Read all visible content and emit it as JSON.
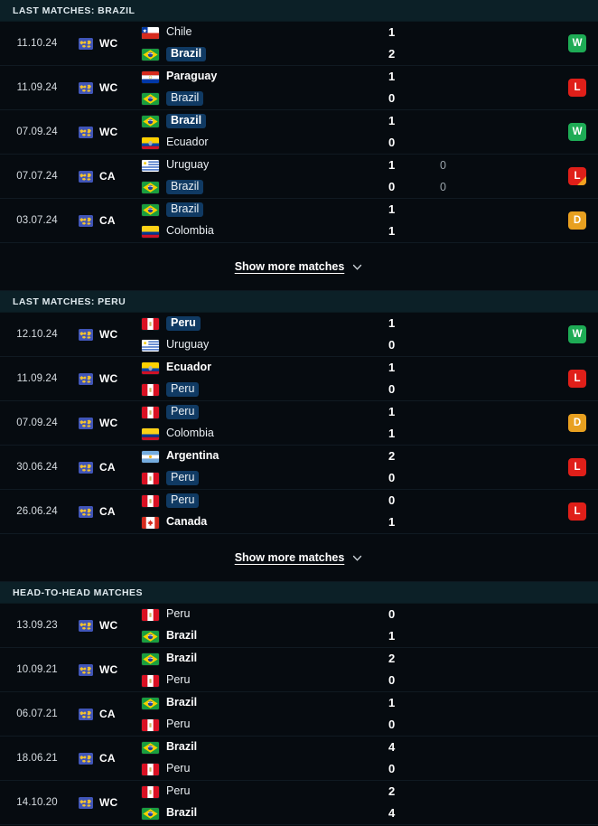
{
  "colors": {
    "page_bg": "#05090d",
    "row_bg": "#060b10",
    "section_header_bg": "#0c2027",
    "highlight_badge": "#103a63",
    "win": "#1eab55",
    "loss": "#e01f19",
    "draw": "#e8a020",
    "penalty_corner": "#f0a020"
  },
  "sections": [
    {
      "id": "last-matches-brazil",
      "title": "LAST MATCHES: BRAZIL",
      "show_more": {
        "label": "Show more matches",
        "icon": "chevron-down-icon"
      },
      "matches": [
        {
          "date": "11.10.24",
          "competition": "WC",
          "competition_icon": "world-cup-icon",
          "home": {
            "team": "Chile",
            "flag": "cl",
            "highlight": false,
            "bold": false
          },
          "away": {
            "team": "Brazil",
            "flag": "br",
            "highlight": true,
            "bold": true
          },
          "score_home": "1",
          "score_away": "2",
          "pen_home": "",
          "pen_away": "",
          "result": "W",
          "penalty_marker": false
        },
        {
          "date": "11.09.24",
          "competition": "WC",
          "competition_icon": "world-cup-icon",
          "home": {
            "team": "Paraguay",
            "flag": "py",
            "highlight": false,
            "bold": true
          },
          "away": {
            "team": "Brazil",
            "flag": "br",
            "highlight": true,
            "bold": false
          },
          "score_home": "1",
          "score_away": "0",
          "pen_home": "",
          "pen_away": "",
          "result": "L",
          "penalty_marker": false
        },
        {
          "date": "07.09.24",
          "competition": "WC",
          "competition_icon": "world-cup-icon",
          "home": {
            "team": "Brazil",
            "flag": "br",
            "highlight": true,
            "bold": true
          },
          "away": {
            "team": "Ecuador",
            "flag": "ec",
            "highlight": false,
            "bold": false
          },
          "score_home": "1",
          "score_away": "0",
          "pen_home": "",
          "pen_away": "",
          "result": "W",
          "penalty_marker": false
        },
        {
          "date": "07.07.24",
          "competition": "CA",
          "competition_icon": "world-cup-icon",
          "home": {
            "team": "Uruguay",
            "flag": "uy",
            "highlight": false,
            "bold": false
          },
          "away": {
            "team": "Brazil",
            "flag": "br",
            "highlight": true,
            "bold": false
          },
          "score_home": "1",
          "score_away": "0",
          "pen_home": "0",
          "pen_away": "0",
          "result": "L",
          "penalty_marker": true
        },
        {
          "date": "03.07.24",
          "competition": "CA",
          "competition_icon": "world-cup-icon",
          "home": {
            "team": "Brazil",
            "flag": "br",
            "highlight": true,
            "bold": false
          },
          "away": {
            "team": "Colombia",
            "flag": "co",
            "highlight": false,
            "bold": false
          },
          "score_home": "1",
          "score_away": "1",
          "pen_home": "",
          "pen_away": "",
          "result": "D",
          "penalty_marker": false
        }
      ]
    },
    {
      "id": "last-matches-peru",
      "title": "LAST MATCHES: PERU",
      "show_more": {
        "label": "Show more matches",
        "icon": "chevron-down-icon"
      },
      "matches": [
        {
          "date": "12.10.24",
          "competition": "WC",
          "competition_icon": "world-cup-icon",
          "home": {
            "team": "Peru",
            "flag": "pe",
            "highlight": true,
            "bold": true
          },
          "away": {
            "team": "Uruguay",
            "flag": "uy",
            "highlight": false,
            "bold": false
          },
          "score_home": "1",
          "score_away": "0",
          "pen_home": "",
          "pen_away": "",
          "result": "W",
          "penalty_marker": false
        },
        {
          "date": "11.09.24",
          "competition": "WC",
          "competition_icon": "world-cup-icon",
          "home": {
            "team": "Ecuador",
            "flag": "ec",
            "highlight": false,
            "bold": true
          },
          "away": {
            "team": "Peru",
            "flag": "pe",
            "highlight": true,
            "bold": false
          },
          "score_home": "1",
          "score_away": "0",
          "pen_home": "",
          "pen_away": "",
          "result": "L",
          "penalty_marker": false
        },
        {
          "date": "07.09.24",
          "competition": "WC",
          "competition_icon": "world-cup-icon",
          "home": {
            "team": "Peru",
            "flag": "pe",
            "highlight": true,
            "bold": false
          },
          "away": {
            "team": "Colombia",
            "flag": "co",
            "highlight": false,
            "bold": false
          },
          "score_home": "1",
          "score_away": "1",
          "pen_home": "",
          "pen_away": "",
          "result": "D",
          "penalty_marker": false
        },
        {
          "date": "30.06.24",
          "competition": "CA",
          "competition_icon": "world-cup-icon",
          "home": {
            "team": "Argentina",
            "flag": "ar",
            "highlight": false,
            "bold": true
          },
          "away": {
            "team": "Peru",
            "flag": "pe",
            "highlight": true,
            "bold": false
          },
          "score_home": "2",
          "score_away": "0",
          "pen_home": "",
          "pen_away": "",
          "result": "L",
          "penalty_marker": false
        },
        {
          "date": "26.06.24",
          "competition": "CA",
          "competition_icon": "world-cup-icon",
          "home": {
            "team": "Peru",
            "flag": "pe",
            "highlight": true,
            "bold": false
          },
          "away": {
            "team": "Canada",
            "flag": "ca",
            "highlight": false,
            "bold": true
          },
          "score_home": "0",
          "score_away": "1",
          "pen_home": "",
          "pen_away": "",
          "result": "L",
          "penalty_marker": false
        }
      ]
    },
    {
      "id": "head-to-head-matches",
      "title": "HEAD-TO-HEAD MATCHES",
      "show_more": null,
      "matches": [
        {
          "date": "13.09.23",
          "competition": "WC",
          "competition_icon": "world-cup-icon",
          "home": {
            "team": "Peru",
            "flag": "pe",
            "highlight": false,
            "bold": false
          },
          "away": {
            "team": "Brazil",
            "flag": "br",
            "highlight": false,
            "bold": true
          },
          "score_home": "0",
          "score_away": "1",
          "pen_home": "",
          "pen_away": "",
          "result": "",
          "penalty_marker": false
        },
        {
          "date": "10.09.21",
          "competition": "WC",
          "competition_icon": "world-cup-icon",
          "home": {
            "team": "Brazil",
            "flag": "br",
            "highlight": false,
            "bold": true
          },
          "away": {
            "team": "Peru",
            "flag": "pe",
            "highlight": false,
            "bold": false
          },
          "score_home": "2",
          "score_away": "0",
          "pen_home": "",
          "pen_away": "",
          "result": "",
          "penalty_marker": false
        },
        {
          "date": "06.07.21",
          "competition": "CA",
          "competition_icon": "world-cup-icon",
          "home": {
            "team": "Brazil",
            "flag": "br",
            "highlight": false,
            "bold": true
          },
          "away": {
            "team": "Peru",
            "flag": "pe",
            "highlight": false,
            "bold": false
          },
          "score_home": "1",
          "score_away": "0",
          "pen_home": "",
          "pen_away": "",
          "result": "",
          "penalty_marker": false
        },
        {
          "date": "18.06.21",
          "competition": "CA",
          "competition_icon": "world-cup-icon",
          "home": {
            "team": "Brazil",
            "flag": "br",
            "highlight": false,
            "bold": true
          },
          "away": {
            "team": "Peru",
            "flag": "pe",
            "highlight": false,
            "bold": false
          },
          "score_home": "4",
          "score_away": "0",
          "pen_home": "",
          "pen_away": "",
          "result": "",
          "penalty_marker": false
        },
        {
          "date": "14.10.20",
          "competition": "WC",
          "competition_icon": "world-cup-icon",
          "home": {
            "team": "Peru",
            "flag": "pe",
            "highlight": false,
            "bold": false
          },
          "away": {
            "team": "Brazil",
            "flag": "br",
            "highlight": false,
            "bold": true
          },
          "score_home": "2",
          "score_away": "4",
          "pen_home": "",
          "pen_away": "",
          "result": "",
          "penalty_marker": false
        }
      ]
    }
  ]
}
